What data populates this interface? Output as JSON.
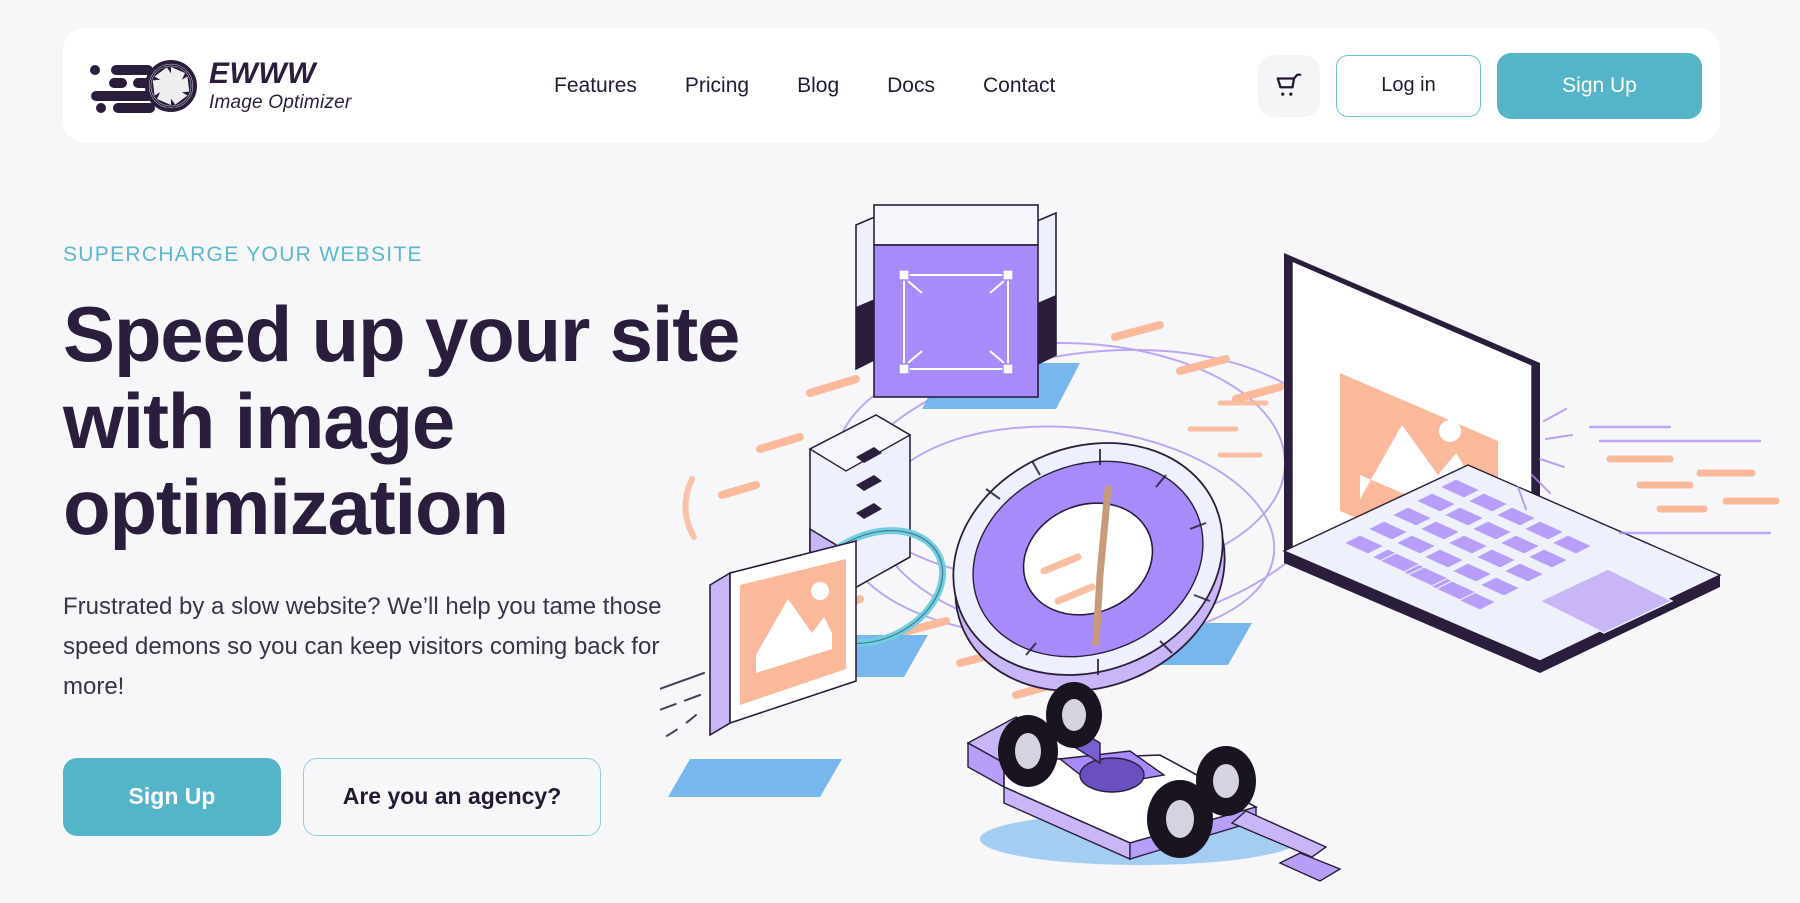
{
  "brand": {
    "name": "EWWW",
    "tagline": "Image Optimizer",
    "logo_icon": "camera-aperture-speed-icon",
    "accent_color": "#54b4c8",
    "dark_color": "#2b1e3c"
  },
  "header": {
    "nav": [
      {
        "label": "Features"
      },
      {
        "label": "Pricing"
      },
      {
        "label": "Blog"
      },
      {
        "label": "Docs"
      },
      {
        "label": "Contact"
      }
    ],
    "cart_icon": "shopping-cart-icon",
    "login_label": "Log in",
    "signup_label": "Sign Up"
  },
  "hero": {
    "eyebrow": "SUPERCHARGE YOUR WEBSITE",
    "headline": "Speed up your site with image optimization",
    "subcopy": "Frustrated by a slow website? We’ll help you tame those speed demons so you can keep visitors coming back for more!",
    "primary_cta": "Sign Up",
    "secondary_cta": "Are you an agency?",
    "illustration": {
      "name": "isometric-speed-optimization-illustration",
      "elements": [
        "isometric-laptop-with-image",
        "formula-one-race-car",
        "speed-gauge-dial",
        "mobile-device",
        "crop-tool-image-frame",
        "floating-image-card",
        "orbit-rings",
        "motion-dashes"
      ],
      "palette": {
        "purple": "#a78bfa",
        "light_purple": "#c9b6f7",
        "peach": "#f9b99a",
        "blue": "#62aceb",
        "pale": "#eef1fb",
        "ink": "#2b1e3c",
        "cyan": "#6ed0e0"
      }
    }
  }
}
